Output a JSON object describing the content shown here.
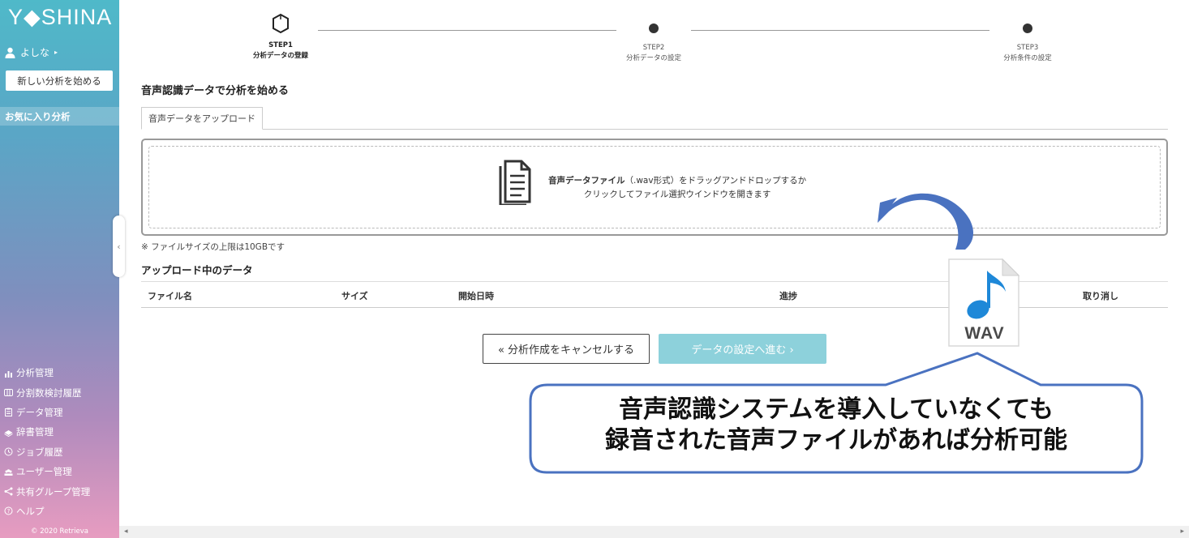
{
  "sidebar": {
    "logo": "Y◆SHINA",
    "user_name": "よしな",
    "new_analysis_button": "新しい分析を始める",
    "favorites_label": "お気に入り分析",
    "nav_items": [
      {
        "label": "分析管理",
        "icon": "bar-chart-icon"
      },
      {
        "label": "分割数検討履歴",
        "icon": "columns-icon"
      },
      {
        "label": "データ管理",
        "icon": "clipboard-icon"
      },
      {
        "label": "辞書管理",
        "icon": "book-icon"
      },
      {
        "label": "ジョブ履歴",
        "icon": "history-icon"
      },
      {
        "label": "ユーザー管理",
        "icon": "users-icon"
      },
      {
        "label": "共有グループ管理",
        "icon": "share-icon"
      },
      {
        "label": "ヘルプ",
        "icon": "help-icon"
      }
    ],
    "copyright": "© 2020 Retrieva",
    "collapse_glyph": "‹"
  },
  "steps": [
    {
      "title": "STEP1",
      "subtitle": "分析データの登録",
      "active": true
    },
    {
      "title": "STEP2",
      "subtitle": "分析データの設定",
      "active": false
    },
    {
      "title": "STEP3",
      "subtitle": "分析条件の設定",
      "active": false
    }
  ],
  "main": {
    "section_title": "音声認識データで分析を始める",
    "tab_label": "音声データをアップロード",
    "drop_text_bold": "音声データファイル",
    "drop_text_rest": "（.wav形式）をドラッグアンドドロップするか",
    "drop_text_line2": "クリックしてファイル選択ウインドウを開きます",
    "limit_note": "※ ファイルサイズの上限は10GBです",
    "uploads_title": "アップロード中のデータ",
    "table_headers": [
      "ファイル名",
      "サイズ",
      "開始日時",
      "進捗",
      "取り消し"
    ],
    "cancel_button": "« 分析作成をキャンセルする",
    "next_button": "データの設定へ進む ›"
  },
  "annotation": {
    "file_badge": "WAV",
    "callout_line1": "音声認識システムを導入していなくても",
    "callout_line2": "録音された音声ファイルがあれば分析可能",
    "arrow_color": "#4a72c0",
    "note_color": "#2f84d6"
  },
  "colors": {
    "accent": "#8dd1db",
    "sidebar_top": "#4fb9c9",
    "sidebar_bottom": "#e79cc0"
  }
}
